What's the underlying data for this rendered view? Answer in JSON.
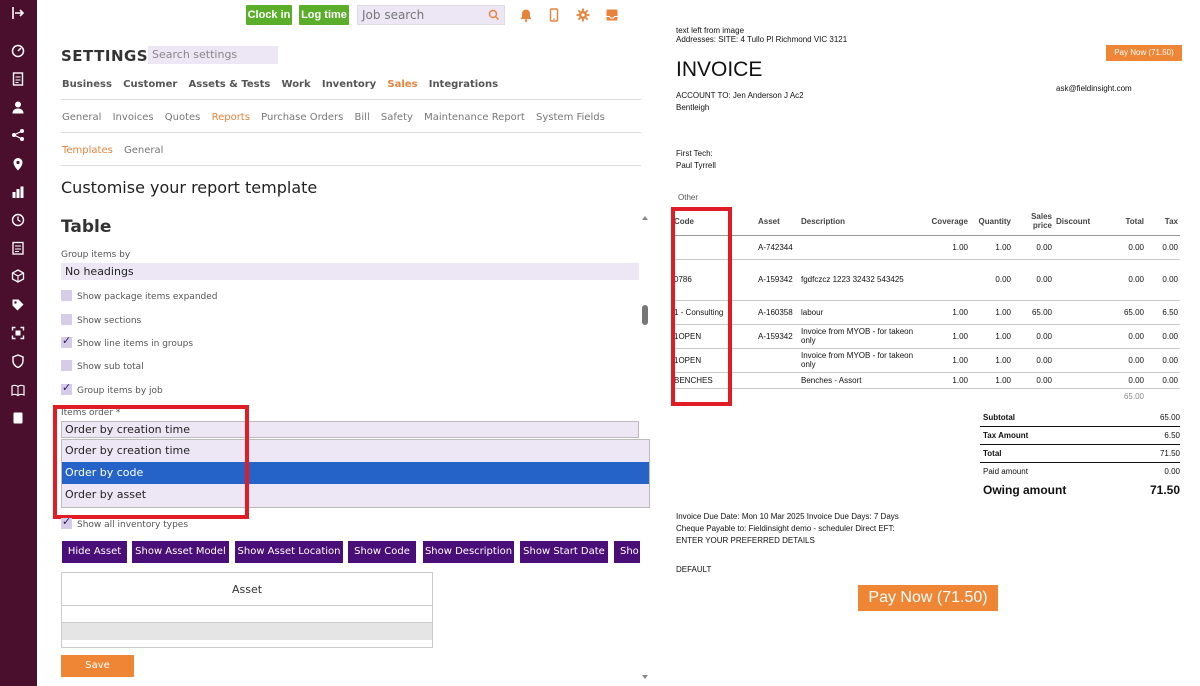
{
  "topbar": {
    "clock_in": "Clock in",
    "log_time": "Log time",
    "job_search_placeholder": "Job search"
  },
  "settings": {
    "title": "SETTINGS",
    "search_placeholder": "Search settings",
    "nav_primary": [
      "Business",
      "Customer",
      "Assets & Tests",
      "Work",
      "Inventory",
      "Sales",
      "Integrations"
    ],
    "nav_secondary": [
      "General",
      "Invoices",
      "Quotes",
      "Reports",
      "Purchase Orders",
      "Bill",
      "Safety",
      "Maintenance Report",
      "System Fields"
    ],
    "nav_tertiary": [
      "Templates",
      "General"
    ],
    "page_heading": "Customise your report template",
    "section_title": "Table",
    "group_label": "Group items by",
    "group_value": "No headings",
    "checkboxes": [
      {
        "label": "Show package items expanded",
        "checked": false
      },
      {
        "label": "Show sections",
        "checked": false
      },
      {
        "label": "Show line items in groups",
        "checked": true
      },
      {
        "label": "Show sub total",
        "checked": false
      },
      {
        "label": "Group items by job",
        "checked": true
      }
    ],
    "items_order_label": "Items order *",
    "items_order_value": "Order by creation time",
    "items_order_options": [
      "Order by creation time",
      "Order by code",
      "Order by asset"
    ],
    "show_inventory_label": "Show all inventory types",
    "column_buttons": [
      "Hide Asset",
      "Show Asset Model",
      "Show Asset Location",
      "Show Code",
      "Show Description",
      "Show Start Date",
      "Sho"
    ],
    "asset_column_header": "Asset",
    "save_label": "Save"
  },
  "invoice": {
    "header_note": "text left from image",
    "address": "Addresses: SITE: 4 Tullo Pl Richmond VIC 3121",
    "pay_now_small": "Pay Now (71.50)",
    "title": "INVOICE",
    "account_to": "ACCOUNT TO: Jen Anderson J Ac2",
    "suburb": "Bentleigh",
    "email": "ask@fieldinsight.com",
    "first_tech_label": "First Tech:",
    "first_tech_name": "Paul Tyrrell",
    "other_label": "Other",
    "columns": [
      "Code",
      "Asset",
      "Description",
      "Coverage",
      "Quantity",
      "Sales price",
      "Discount",
      "Total",
      "Tax"
    ],
    "rows": [
      {
        "code": "",
        "asset": "A-742344",
        "description": "",
        "coverage": "1.00",
        "quantity": "1.00",
        "price": "0.00",
        "discount": "",
        "total": "0.00",
        "tax": "0.00"
      },
      {
        "code": "0786",
        "asset": "A-159342",
        "description": "fgdfczcz 1223 32432 543425",
        "coverage": "",
        "quantity": "0.00",
        "price": "0.00",
        "discount": "",
        "total": "0.00",
        "tax": "0.00"
      },
      {
        "code": "1 - Consulting",
        "asset": "A-160358",
        "description": "labour",
        "coverage": "1.00",
        "quantity": "1.00",
        "price": "65.00",
        "discount": "",
        "total": "65.00",
        "tax": "6.50"
      },
      {
        "code": "1OPEN",
        "asset": "A-159342",
        "description": "Invoice from MYOB - for takeon only",
        "coverage": "1.00",
        "quantity": "1.00",
        "price": "0.00",
        "discount": "",
        "total": "0.00",
        "tax": "0.00"
      },
      {
        "code": "1OPEN",
        "asset": "",
        "description": "Invoice from MYOB - for takeon only",
        "coverage": "1.00",
        "quantity": "1.00",
        "price": "0.00",
        "discount": "",
        "total": "0.00",
        "tax": "0.00"
      },
      {
        "code": "BENCHES",
        "asset": "",
        "description": "Benches - Assort",
        "coverage": "1.00",
        "quantity": "1.00",
        "price": "0.00",
        "discount": "",
        "total": "0.00",
        "tax": "0.00"
      }
    ],
    "table_footer_total": "65.00",
    "subtotal_label": "Subtotal",
    "subtotal_value": "65.00",
    "tax_label": "Tax Amount",
    "tax_value": "6.50",
    "total_label": "Total",
    "total_value": "71.50",
    "paid_label": "Paid amount",
    "paid_value": "0.00",
    "owing_label": "Owing amount",
    "owing_value": "71.50",
    "due_date": "Invoice Due Date: Mon 10 Mar 2025 Invoice Due Days: 7 Days",
    "cheque": "Cheque Payable to: Fieldinsight demo - scheduler Direct EFT:",
    "preferred": "ENTER YOUR PREFERRED DETAILS",
    "default": "DEFAULT",
    "pay_now_big": "Pay Now (71.50)"
  },
  "colors": {
    "sidebar": "#4b0f2e",
    "green": "#5aae2a",
    "accent_orange": "#ef8635",
    "purple_button": "#4a0e78",
    "selection_blue": "#2563c9",
    "highlight_red": "#e01c24"
  }
}
